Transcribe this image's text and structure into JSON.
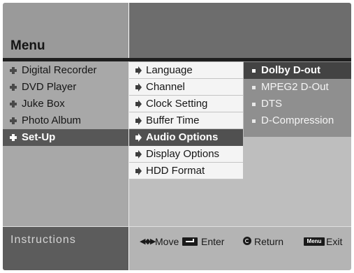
{
  "header": {
    "title": "Menu"
  },
  "main_menu": {
    "items": [
      {
        "label": "Digital Recorder",
        "selected": false
      },
      {
        "label": "DVD Player",
        "selected": false
      },
      {
        "label": "Juke Box",
        "selected": false
      },
      {
        "label": "Photo Album",
        "selected": false
      },
      {
        "label": "Set-Up",
        "selected": true
      }
    ]
  },
  "setup_menu": {
    "items": [
      {
        "label": "Language",
        "selected": false
      },
      {
        "label": "Channel",
        "selected": false
      },
      {
        "label": "Clock Setting",
        "selected": false
      },
      {
        "label": "Buffer Time",
        "selected": false
      },
      {
        "label": "Audio Options",
        "selected": true
      },
      {
        "label": "Display Options",
        "selected": false
      },
      {
        "label": "HDD Format",
        "selected": false
      }
    ]
  },
  "audio_menu": {
    "items": [
      {
        "label": "Dolby D-out",
        "selected": true
      },
      {
        "label": "MPEG2 D-Out",
        "selected": false
      },
      {
        "label": "DTS",
        "selected": false
      },
      {
        "label": "D-Compression",
        "selected": false
      }
    ]
  },
  "instructions": {
    "title": "Instructions",
    "move_label": "Move",
    "enter_label": "Enter",
    "return_label": "Return",
    "menu_key_label": "Menu",
    "exit_label": "Exit",
    "move_keys": "◀◆▶"
  },
  "colors": {
    "header_left": "#9a9a9a",
    "header_right": "#6d6d6d",
    "selected_bg": "#505050",
    "submenu_bg": "#f4f4f4"
  },
  "icons": {
    "main_menu_item": "plus-icon",
    "setup_menu_item": "arrow-right-icon",
    "audio_menu_item": "square-bullet-icon"
  }
}
